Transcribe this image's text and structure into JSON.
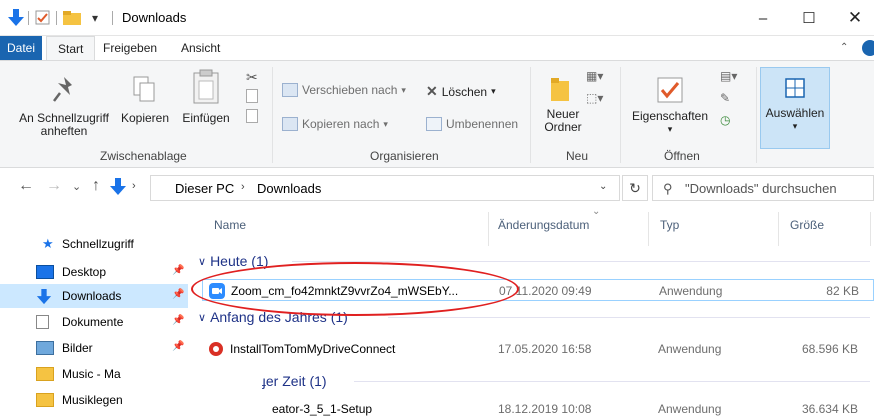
{
  "titlebar": {
    "title": "Downloads",
    "controls": {
      "minimize": "–",
      "maximize": "☐",
      "close": "✕"
    }
  },
  "ribbon_tabs": [
    "Datei",
    "Start",
    "Freigeben",
    "Ansicht"
  ],
  "ribbon": {
    "clipboard": {
      "pin_label_1": "An Schnellzugriff",
      "pin_label_2": "anheften",
      "copy_label": "Kopieren",
      "paste_label": "Einfügen",
      "group_label": "Zwischenablage"
    },
    "organize": {
      "move_to": "Verschieben nach",
      "copy_to": "Kopieren nach",
      "delete": "Löschen",
      "rename": "Umbenennen",
      "group_label": "Organisieren"
    },
    "new": {
      "new_folder_1": "Neuer",
      "new_folder_2": "Ordner",
      "group_label": "Neu"
    },
    "open": {
      "properties": "Eigenschaften",
      "group_label": "Öffnen"
    },
    "select": {
      "select_label": "Auswählen"
    }
  },
  "address": {
    "crumbs": [
      "Dieser PC",
      "Downloads"
    ],
    "search_placeholder": "\"Downloads\" durchsuchen"
  },
  "nav": {
    "quick_access": "Schnellzugriff",
    "items": [
      {
        "label": "Desktop",
        "pinned": true
      },
      {
        "label": "Downloads",
        "pinned": true,
        "selected": true
      },
      {
        "label": "Dokumente",
        "pinned": true
      },
      {
        "label": "Bilder",
        "pinned": true
      },
      {
        "label": "Music - Ma",
        "pinned": false
      },
      {
        "label": "Musiklegen",
        "pinned": false
      }
    ]
  },
  "columns": [
    "Name",
    "Änderungsdatum",
    "Typ",
    "Größe"
  ],
  "groups": [
    {
      "label": "Heute (1)",
      "files": [
        {
          "name": "Zoom_cm_fo42mnktZ9vvrZo4_mWSEbY...",
          "date": "07.11.2020 09:49",
          "type": "Anwendung",
          "size": "82 KB"
        }
      ]
    },
    {
      "label": "Anfang des Jahres (1)",
      "files": [
        {
          "name": "InstallTomTomMyDriveConnect",
          "date": "17.05.2020 16:58",
          "type": "Anwendung",
          "size": "68.596 KB"
        }
      ]
    },
    {
      "label": "ɟer Zeit (1)",
      "files": [
        {
          "name": "eator-3_5_1-Setup",
          "date": "18.12.2019 10:08",
          "type": "Anwendung",
          "size": "36.634 KB"
        }
      ]
    }
  ],
  "colors": {
    "accent": "#1a65b0",
    "selection": "#cce8ff",
    "group_header": "#1e3287",
    "annotation": "#e02020"
  }
}
